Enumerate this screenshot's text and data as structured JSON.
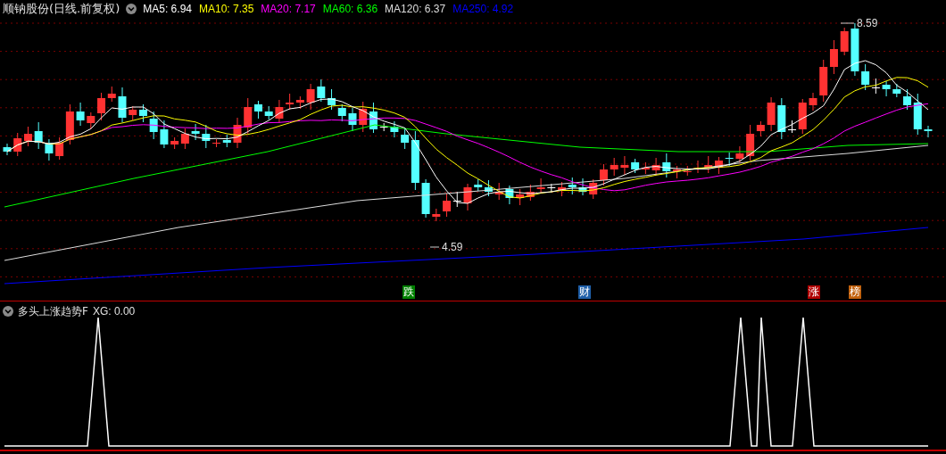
{
  "stock_title": "顺钠股份(日线.前复权)",
  "moving_averages": [
    {
      "label": "MA5: 6.94",
      "color": "#ffffff"
    },
    {
      "label": "MA10: 7.35",
      "color": "#ffff00"
    },
    {
      "label": "MA20: 7.17",
      "color": "#ff00ff"
    },
    {
      "label": "MA60: 6.36",
      "color": "#00ff00"
    },
    {
      "label": "MA120: 6.37",
      "color": "#dddddd"
    },
    {
      "label": "MA250: 4.92",
      "color": "#0000ff"
    }
  ],
  "price_labels": [
    {
      "kind": "high",
      "text": "8.59"
    },
    {
      "kind": "low",
      "text": "4.59"
    }
  ],
  "event_markers": [
    {
      "text": "跌",
      "color": "#008000"
    },
    {
      "text": "财",
      "color": "#1f5fa8"
    },
    {
      "text": "涨",
      "color": "#b00000"
    },
    {
      "text": "榜",
      "color": "#c0600c"
    }
  ],
  "indicator": {
    "title": "多头上涨趋势F",
    "reading": "XG: 0.00"
  }
}
